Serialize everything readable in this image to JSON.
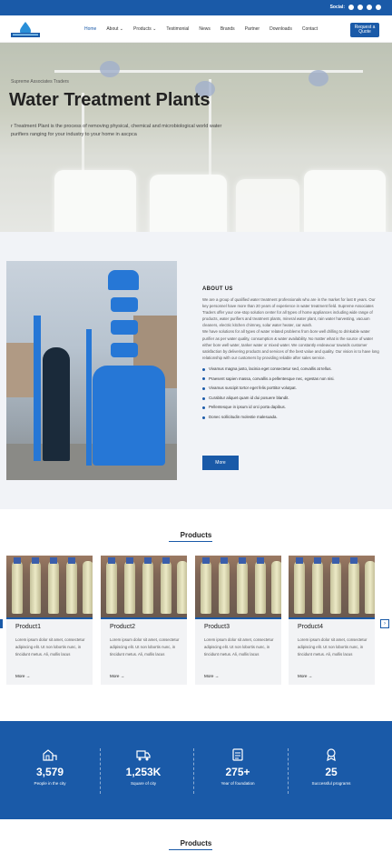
{
  "topbar": {
    "social_label": "Social:",
    "icons": [
      "facebook-icon",
      "instagram-icon",
      "linkedin-icon",
      "twitter-icon"
    ]
  },
  "nav": {
    "items": [
      "Home",
      "About ⌄",
      "Products ⌄",
      "Testimonial",
      "News",
      "Brands",
      "Partner",
      "Downloads",
      "Contact"
    ],
    "active": "Home",
    "quote_button": "Request a Quote"
  },
  "hero": {
    "breadcrumb": "Supreme Associates Traders",
    "title": "Water Treatment Plants",
    "description": "r Treatment Plant is the process of removing physical, chemical and microbiological world water purifiers ranging for your industry to your home in ascpca"
  },
  "about": {
    "heading": "ABOUT US",
    "paragraph1": "We are a group of qualified water treatment professionals who are in the market for last 8 years. Our key personnel have more than 20 years of experience in water treatment field. Supreme Associates Traders offer your one-stop solution center for all types of home appliances including wide range of products, water purifiers and treatment plants, mineral water plant, rain water harvesting, vacuum cleaners, electric kitchen chimney, solar water heater, car wash.",
    "paragraph2": "We have solutions for all types of water related problems from bore well drilling to drinkable water purifier as per water quality, consumption & water availability. No matter what is the source of water either bore well water, tanker water or mixed water. We constantly endeavour towards customer satisfaction by delivering products and services of the best value and quality. Our vision is to have long relationship with our customers by providing reliable after sales service.",
    "bullets": [
      "Vivamus magna justo, lacinia eget consectetur sed, convallis at tellus.",
      "Praesent sapien massa, convallis a pellentesque nec, egestas non nisi.",
      "Vivamus suscipit tortor eget felis porttitor volutpat.",
      "Curabitur aliquet quam id dui posuere blandit.",
      "Pellentesque in ipsum id orci porta dapibus.",
      "Donec sollicitudin molestie malesuada."
    ],
    "more_button": "More"
  },
  "products": {
    "title": "Products",
    "cards": [
      {
        "name": "Product1",
        "desc": "Lorem ipsum dolor sit amet, consectetur adipiscing elit. Ut non lobortis nunc, in tincidunt metus. Ali, mollis lacus",
        "link": "More →"
      },
      {
        "name": "Product2",
        "desc": "Lorem ipsum dolor sit amet, consectetur adipiscing elit. Ut non lobortis nunc, in tincidunt metus. Ali, mollis lacus",
        "link": "More →"
      },
      {
        "name": "Product3",
        "desc": "Lorem ipsum dolor sit amet, consectetur adipiscing elit. Ut non lobortis nunc, in tincidunt metus. Ali, mollis lacus",
        "link": "More →"
      },
      {
        "name": "Product4",
        "desc": "Lorem ipsum dolor sit amet, consectetur adipiscing elit. Ut non lobortis nunc, in tincidunt metus. Ali, mollis lacus",
        "link": "More →"
      }
    ],
    "next_arrow": "›"
  },
  "stats": [
    {
      "value": "3,579",
      "label": "People in the city",
      "icon": "city-icon"
    },
    {
      "value": "1,253K",
      "label": "Square of city",
      "icon": "truck-icon"
    },
    {
      "value": "275+",
      "label": "Year of foundation",
      "icon": "document-icon"
    },
    {
      "value": "25",
      "label": "Successful programs",
      "icon": "award-icon"
    }
  ],
  "bottom": {
    "title": "Products"
  },
  "colors": {
    "brand": "#1a5aa8",
    "light_bg": "#f1f3f7"
  }
}
